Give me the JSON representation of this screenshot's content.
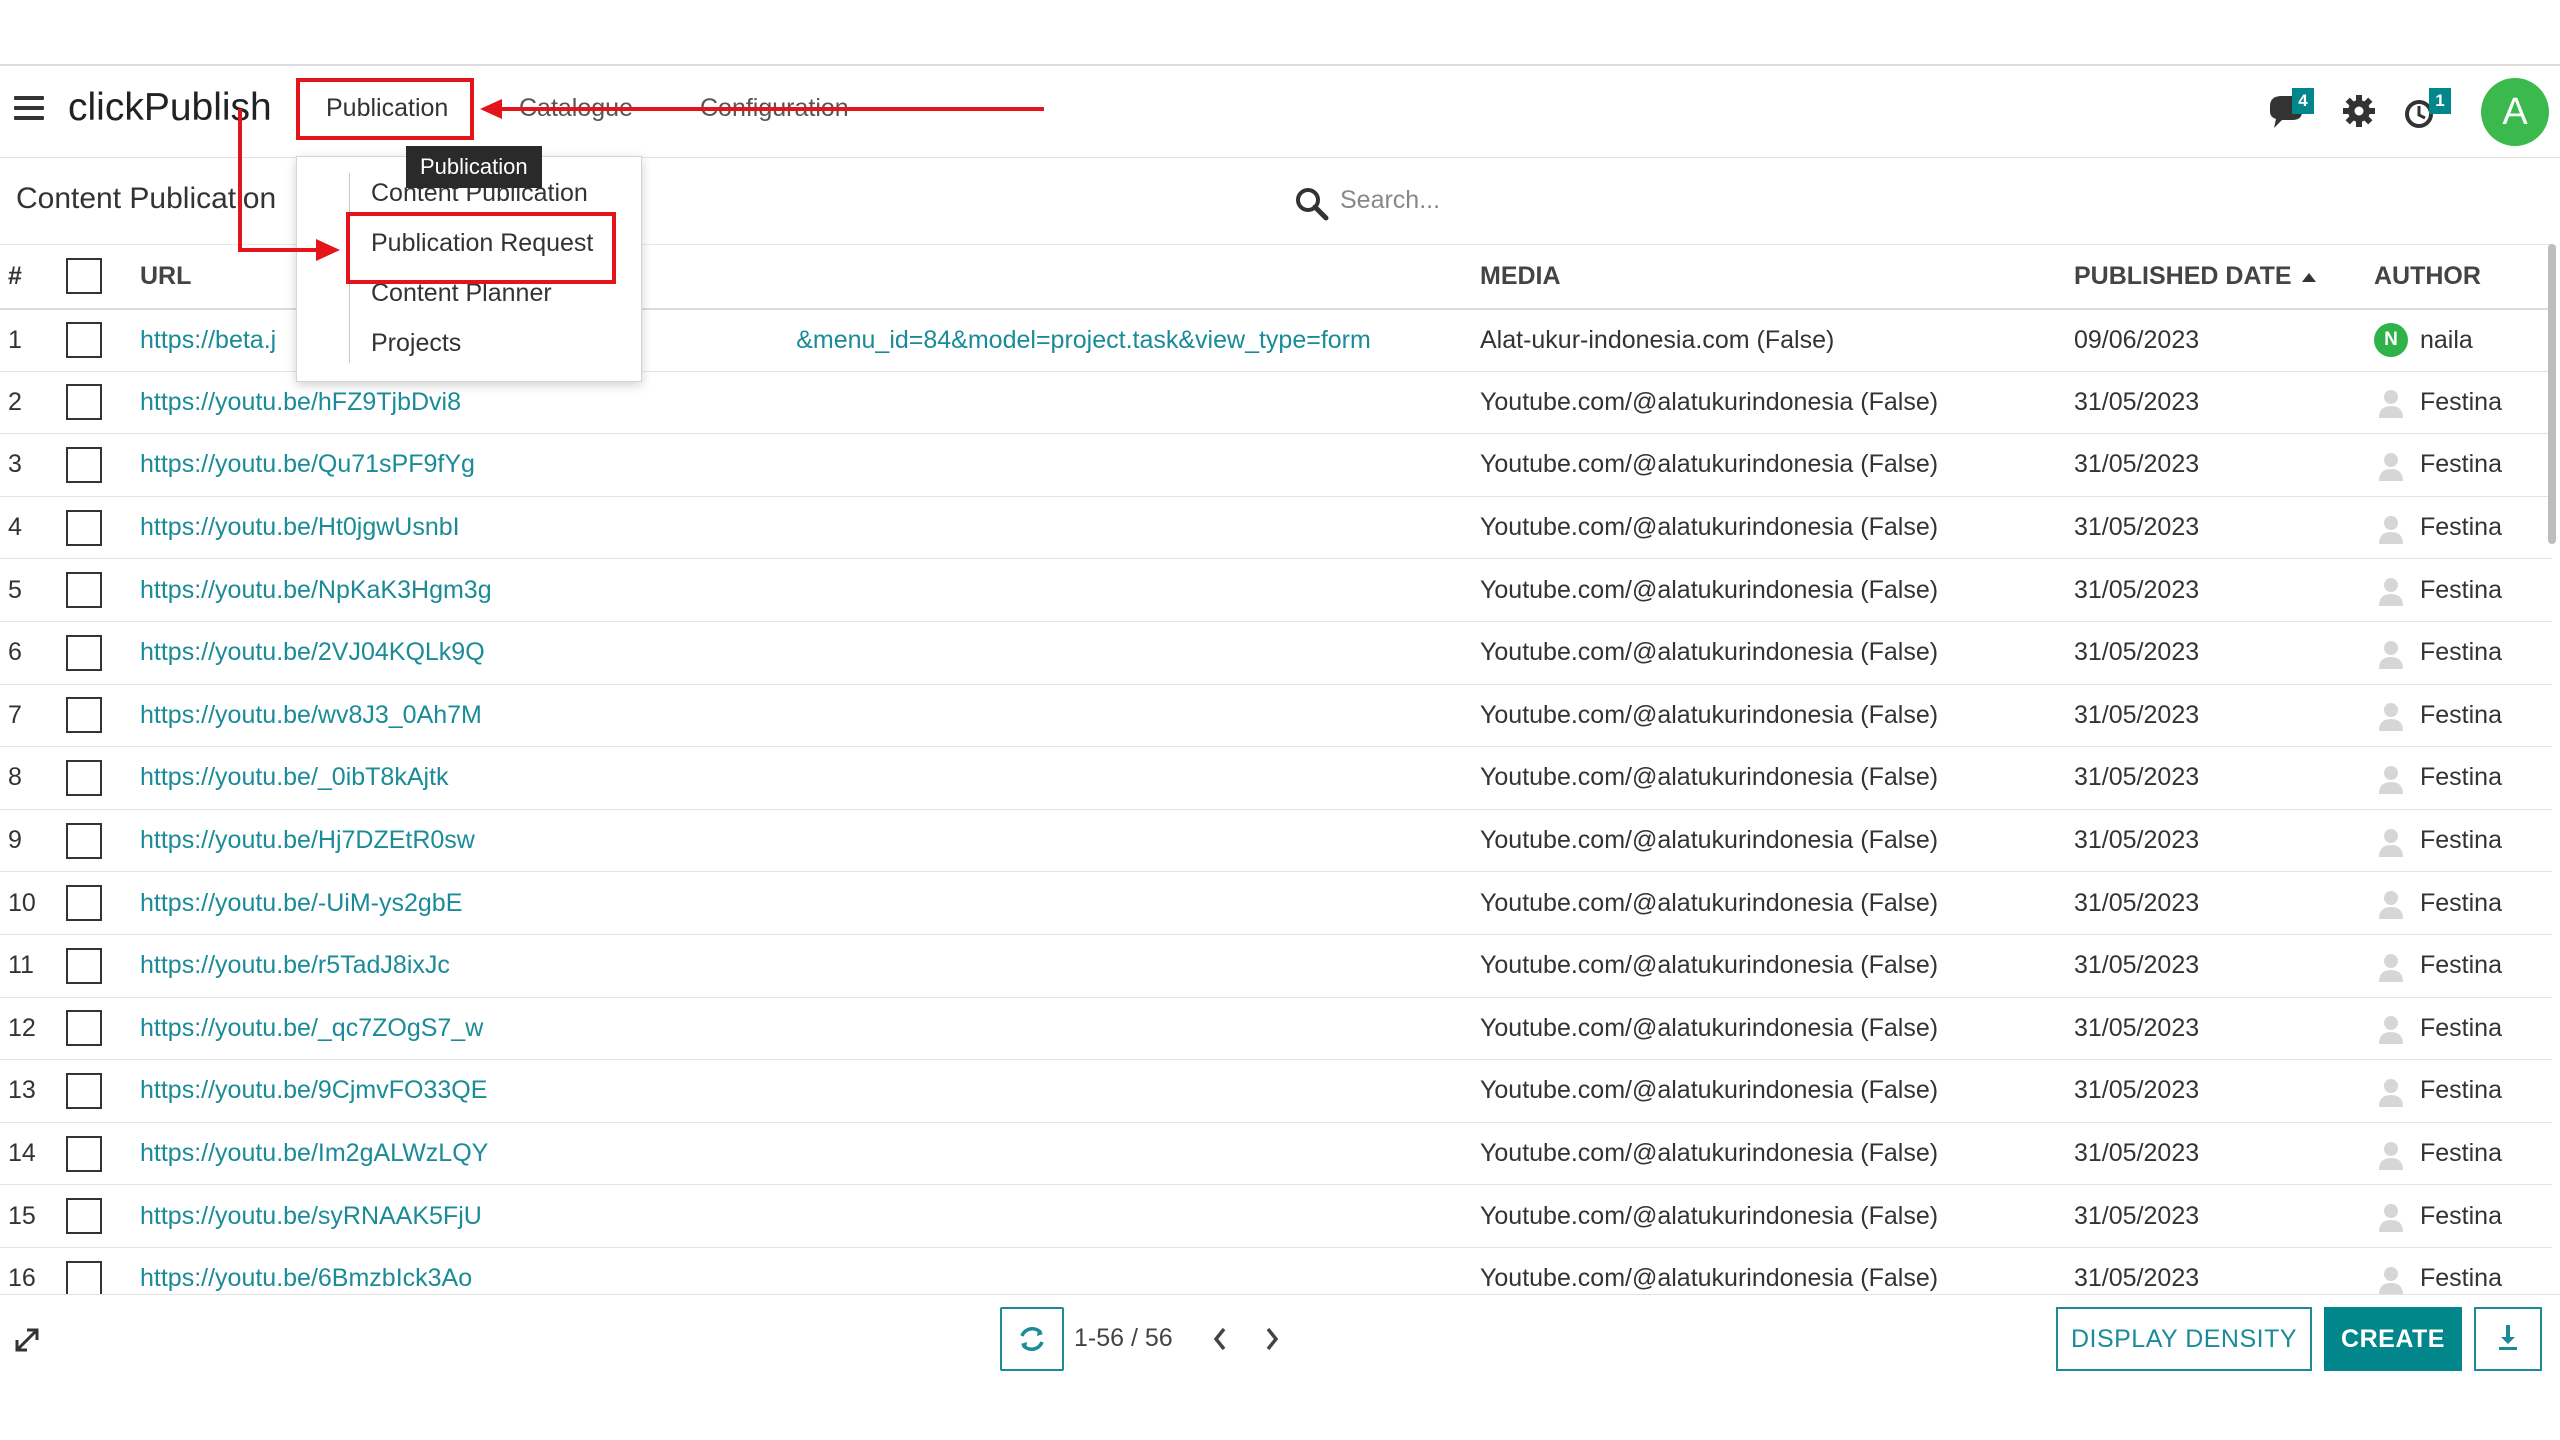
{
  "app": {
    "brand": "clickPublish"
  },
  "nav": {
    "items": [
      "Publication",
      "Catalogue",
      "Configuration"
    ],
    "chat_badge": "4",
    "activity_badge": "1",
    "avatar_letter": "A"
  },
  "control": {
    "breadcrumb": "Content Publication",
    "search_placeholder": "Search..."
  },
  "dropdown": {
    "tooltip": "Publication",
    "items": [
      "Content Publication",
      "Publication Request",
      "Content Planner",
      "Projects"
    ]
  },
  "table": {
    "headers": {
      "num": "#",
      "url": "URL",
      "media": "MEDIA",
      "date": "PUBLISHED DATE",
      "author": "AUTHOR"
    },
    "rows": [
      {
        "num": "1",
        "url": "https://beta.j",
        "url_tail": "&menu_id=84&model=project.task&view_type=form",
        "media": "Alat-ukur-indonesia.com (False)",
        "date": "09/06/2023",
        "author": "naila",
        "author_initial": "N"
      },
      {
        "num": "2",
        "url": "https://youtu.be/hFZ9TjbDvi8",
        "media": "Youtube.com/@alatukurindonesia (False)",
        "date": "31/05/2023",
        "author": "Festina"
      },
      {
        "num": "3",
        "url": "https://youtu.be/Qu71sPF9fYg",
        "media": "Youtube.com/@alatukurindonesia (False)",
        "date": "31/05/2023",
        "author": "Festina"
      },
      {
        "num": "4",
        "url": "https://youtu.be/Ht0jgwUsnbI",
        "media": "Youtube.com/@alatukurindonesia (False)",
        "date": "31/05/2023",
        "author": "Festina"
      },
      {
        "num": "5",
        "url": "https://youtu.be/NpKaK3Hgm3g",
        "media": "Youtube.com/@alatukurindonesia (False)",
        "date": "31/05/2023",
        "author": "Festina"
      },
      {
        "num": "6",
        "url": "https://youtu.be/2VJ04KQLk9Q",
        "media": "Youtube.com/@alatukurindonesia (False)",
        "date": "31/05/2023",
        "author": "Festina"
      },
      {
        "num": "7",
        "url": "https://youtu.be/wv8J3_0Ah7M",
        "media": "Youtube.com/@alatukurindonesia (False)",
        "date": "31/05/2023",
        "author": "Festina"
      },
      {
        "num": "8",
        "url": "https://youtu.be/_0ibT8kAjtk",
        "media": "Youtube.com/@alatukurindonesia (False)",
        "date": "31/05/2023",
        "author": "Festina"
      },
      {
        "num": "9",
        "url": "https://youtu.be/Hj7DZEtR0sw",
        "media": "Youtube.com/@alatukurindonesia (False)",
        "date": "31/05/2023",
        "author": "Festina"
      },
      {
        "num": "10",
        "url": "https://youtu.be/-UiM-ys2gbE",
        "media": "Youtube.com/@alatukurindonesia (False)",
        "date": "31/05/2023",
        "author": "Festina"
      },
      {
        "num": "11",
        "url": "https://youtu.be/r5TadJ8ixJc",
        "media": "Youtube.com/@alatukurindonesia (False)",
        "date": "31/05/2023",
        "author": "Festina"
      },
      {
        "num": "12",
        "url": "https://youtu.be/_qc7ZOgS7_w",
        "media": "Youtube.com/@alatukurindonesia (False)",
        "date": "31/05/2023",
        "author": "Festina"
      },
      {
        "num": "13",
        "url": "https://youtu.be/9CjmvFO33QE",
        "media": "Youtube.com/@alatukurindonesia (False)",
        "date": "31/05/2023",
        "author": "Festina"
      },
      {
        "num": "14",
        "url": "https://youtu.be/Im2gALWzLQY",
        "media": "Youtube.com/@alatukurindonesia (False)",
        "date": "31/05/2023",
        "author": "Festina"
      },
      {
        "num": "15",
        "url": "https://youtu.be/syRNAAK5FjU",
        "media": "Youtube.com/@alatukurindonesia (False)",
        "date": "31/05/2023",
        "author": "Festina"
      },
      {
        "num": "16",
        "url": "https://youtu.be/6BmzbIck3Ao",
        "media": "Youtube.com/@alatukurindonesia (False)",
        "date": "31/05/2023",
        "author": "Festina"
      }
    ]
  },
  "footer": {
    "pager": "1-56 / 56",
    "display_density": "DISPLAY DENSITY",
    "create": "CREATE"
  },
  "colors": {
    "accent": "#00868b",
    "link": "#1a8b97",
    "annotation": "#e4141b",
    "avatar": "#3cb94d"
  }
}
